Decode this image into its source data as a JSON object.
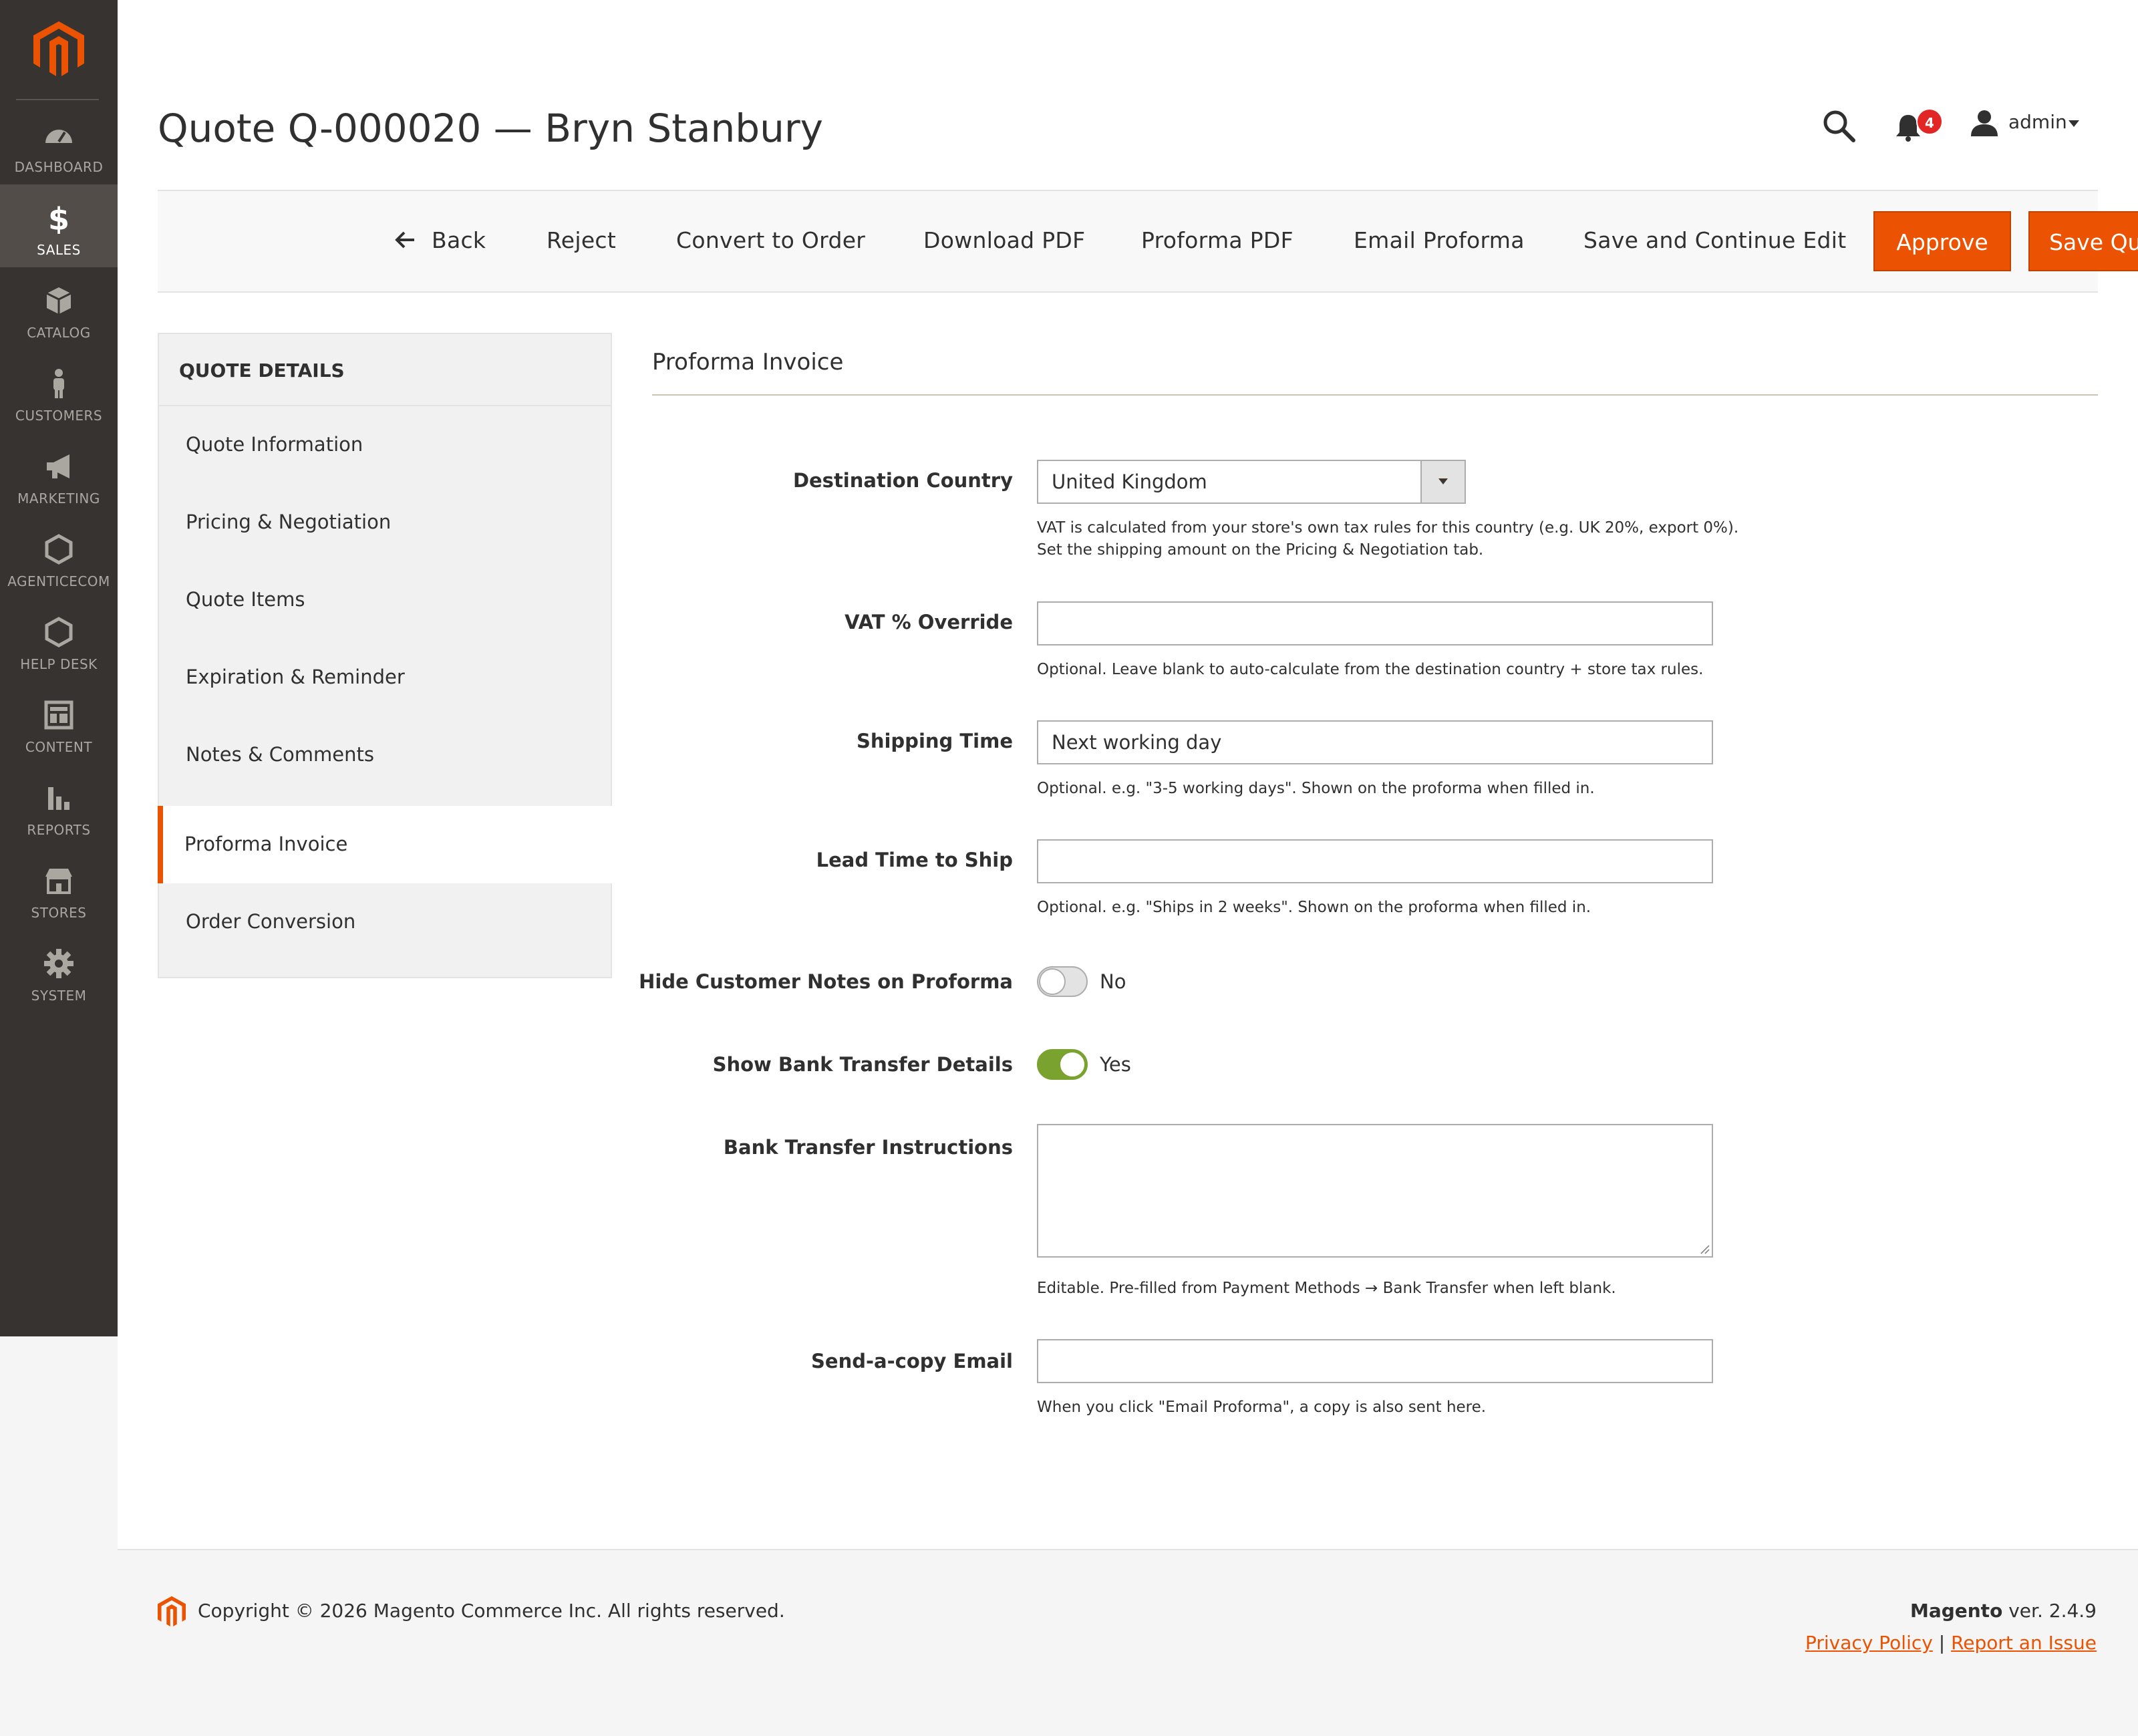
{
  "brand": {
    "accent": "#eb5202",
    "sidebar_bg": "#373330",
    "toggle_on": "#79a22e"
  },
  "sidebar": {
    "items": [
      {
        "label": "DASHBOARD",
        "icon": "dashboard-icon"
      },
      {
        "label": "SALES",
        "icon": "dollar-icon",
        "active": true
      },
      {
        "label": "CATALOG",
        "icon": "cube-icon"
      },
      {
        "label": "CUSTOMERS",
        "icon": "person-icon"
      },
      {
        "label": "MARKETING",
        "icon": "megaphone-icon"
      },
      {
        "label": "AGENTICECOM",
        "icon": "hexagon-icon"
      },
      {
        "label": "HELP DESK",
        "icon": "hexagon-icon"
      },
      {
        "label": "CONTENT",
        "icon": "layout-icon"
      },
      {
        "label": "REPORTS",
        "icon": "bar-chart-icon"
      },
      {
        "label": "STORES",
        "icon": "storefront-icon"
      },
      {
        "label": "SYSTEM",
        "icon": "gear-icon"
      }
    ]
  },
  "header": {
    "title": "Quote Q-000020 — Bryn Stanbury",
    "notifications_count": "4",
    "user": "admin"
  },
  "actions": {
    "back": "Back",
    "reject": "Reject",
    "convert": "Convert to Order",
    "download_pdf": "Download PDF",
    "proforma_pdf": "Proforma PDF",
    "email_proforma": "Email Proforma",
    "save_continue": "Save and Continue Edit",
    "approve": "Approve",
    "save_quote": "Save Quote"
  },
  "tabs": {
    "title": "QUOTE DETAILS",
    "items": [
      "Quote Information",
      "Pricing & Negotiation",
      "Quote Items",
      "Expiration & Reminder",
      "Notes & Comments",
      "Proforma Invoice",
      "Order Conversion"
    ],
    "active_index": 5
  },
  "form": {
    "section_title": "Proforma Invoice",
    "destination_country": {
      "label": "Destination Country",
      "value": "United Kingdom",
      "note_line1": "VAT is calculated from your store's own tax rules for this country (e.g. UK 20%, export 0%).",
      "note_line2": "Set the shipping amount on the Pricing & Negotiation tab."
    },
    "vat_override": {
      "label": "VAT % Override",
      "value": "",
      "note": "Optional. Leave blank to auto-calculate from the destination country + store tax rules."
    },
    "shipping_time": {
      "label": "Shipping Time",
      "value": "Next working day",
      "note": "Optional. e.g. \"3-5 working days\". Shown on the proforma when filled in."
    },
    "lead_time": {
      "label": "Lead Time to Ship",
      "value": "",
      "note": "Optional. e.g. \"Ships in 2 weeks\". Shown on the proforma when filled in."
    },
    "hide_notes": {
      "label": "Hide Customer Notes on Proforma",
      "state": "No"
    },
    "show_bank": {
      "label": "Show Bank Transfer Details",
      "state": "Yes"
    },
    "bank_instructions": {
      "label": "Bank Transfer Instructions",
      "value": "",
      "note": "Editable. Pre-filled from Payment Methods → Bank Transfer when left blank."
    },
    "copy_email": {
      "label": "Send-a-copy Email",
      "value": "",
      "note": "When you click \"Email Proforma\", a copy is also sent here."
    }
  },
  "footer": {
    "copyright": "Copyright © 2026 Magento Commerce Inc. All rights reserved.",
    "brand": "Magento",
    "version": " ver. 2.4.9",
    "privacy": "Privacy Policy",
    "separator": " | ",
    "report": "Report an Issue"
  }
}
